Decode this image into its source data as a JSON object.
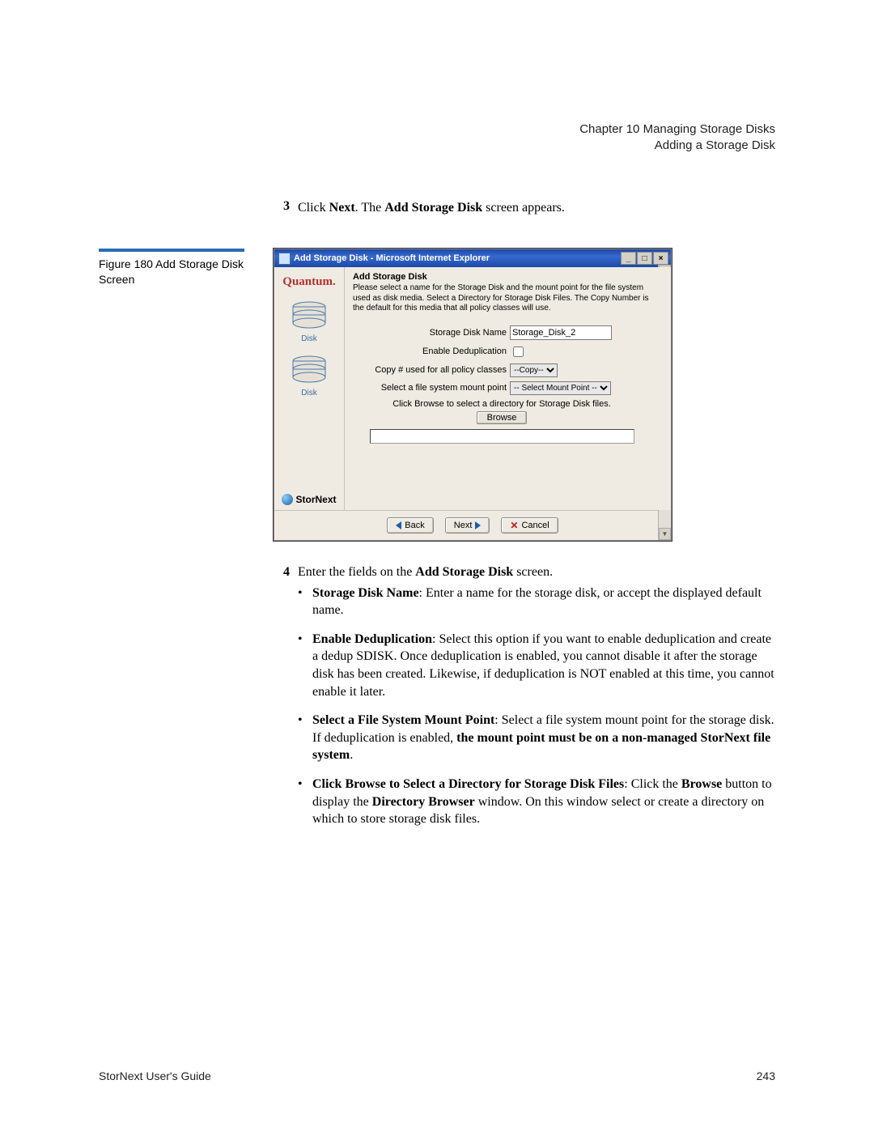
{
  "header": {
    "chapter": "Chapter 10  Managing Storage Disks",
    "section": "Adding a Storage Disk"
  },
  "step3": {
    "num": "3",
    "pre": "Click ",
    "b1": "Next",
    "mid": ". The ",
    "b2": "Add Storage Disk",
    "post": " screen appears."
  },
  "figure": {
    "label": "Figure 180  Add Storage Disk Screen"
  },
  "screenshot": {
    "title": "Add Storage Disk - Microsoft Internet Explorer",
    "logo": "Quantum.",
    "disk_label": "Disk",
    "stornext": "StorNext",
    "heading": "Add Storage Disk",
    "intro": "Please select a name for the Storage Disk and the mount point for the file system used as disk media. Select a Directory for Storage Disk Files. The Copy Number is the default for this media that all policy classes will use.",
    "labels": {
      "name": "Storage Disk Name",
      "dedup": "Enable Deduplication",
      "copy": "Copy # used for all policy classes",
      "mount": "Select a file system mount point",
      "browse_note": "Click Browse to select a directory for Storage Disk files.",
      "browse": "Browse"
    },
    "values": {
      "name": "Storage_Disk_2",
      "copy_sel": " --Copy-- ",
      "mount_sel": " -- Select Mount Point -- "
    },
    "buttons": {
      "back": "Back",
      "next": "Next",
      "cancel": "Cancel"
    }
  },
  "step4": {
    "num": "4",
    "pre": "Enter the fields on the ",
    "b1": "Add Storage Disk",
    "post": " screen."
  },
  "bullets": {
    "b1": {
      "label": "Storage Disk Name",
      "text": ": Enter a name for the storage disk, or accept the displayed default name."
    },
    "b2": {
      "label": "Enable Deduplication",
      "text": ": Select this option if you want to enable deduplication and create a dedup SDISK. Once deduplication is enabled, you cannot disable it after the storage disk has been created. Likewise, if deduplication is NOT enabled at this time, you cannot enable it later."
    },
    "b3": {
      "label": "Select a File System Mount Point",
      "text_a": ": Select a file system mount point for the storage disk. If deduplication is enabled, ",
      "bold_tail": "the mount point must be on a non-managed StorNext file system",
      "period": "."
    },
    "b4": {
      "label": "Click Browse to Select a Directory for Storage Disk Files",
      "text_a": ": Click the ",
      "b_browse": "Browse",
      "text_b": " button to display the ",
      "b_dir": "Directory Browser",
      "text_c": " window. On this window select or create a directory on which to store storage disk files."
    }
  },
  "footer": {
    "left": "StorNext User's Guide",
    "right": "243"
  }
}
